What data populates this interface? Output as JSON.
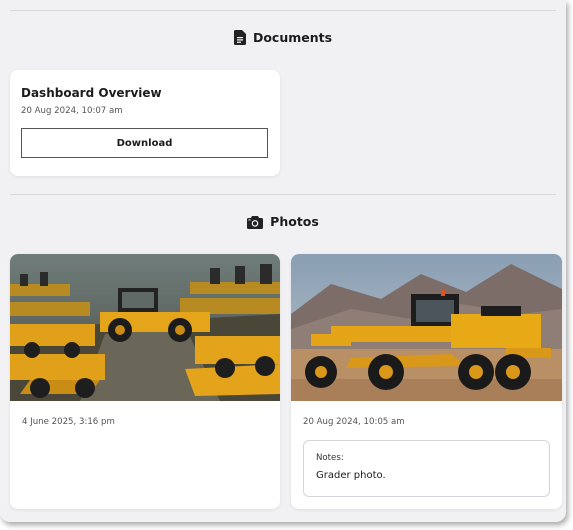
{
  "documents": {
    "heading": "Documents",
    "icon": "document-icon",
    "items": [
      {
        "title": "Dashboard Overview",
        "date": "20 Aug 2024, 10:07 am",
        "button_label": "Download"
      }
    ]
  },
  "photos": {
    "heading": "Photos",
    "icon": "camera-icon",
    "items": [
      {
        "date": "4 June 2025, 3:16 pm",
        "image": "yard of yellow construction machinery"
      },
      {
        "date": "20 Aug 2024, 10:05 am",
        "image": "yellow motor grader in desert",
        "notes_label": "Notes:",
        "notes": "Grader photo."
      }
    ]
  },
  "colors": {
    "machine_yellow": "#e8a417",
    "panel_bg": "#f1f1f4",
    "card_bg": "#ffffff"
  }
}
